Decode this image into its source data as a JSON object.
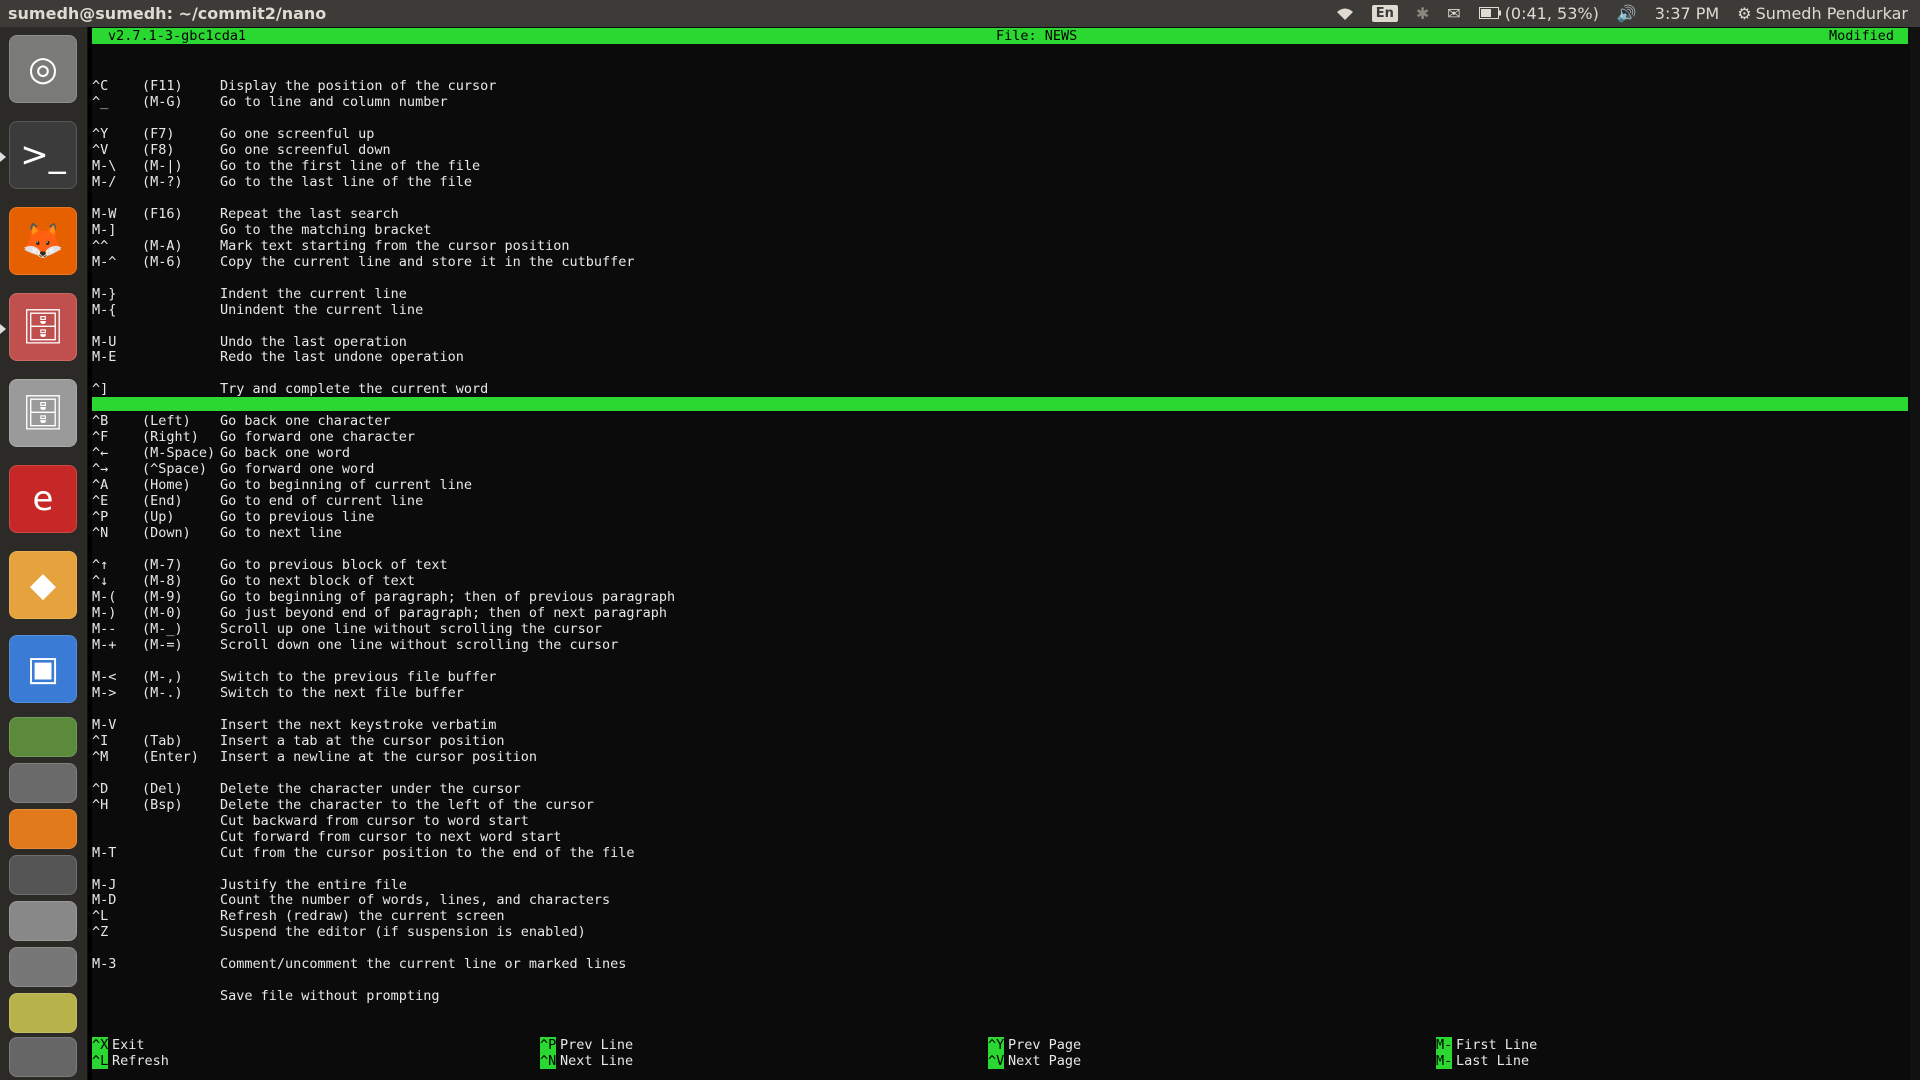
{
  "panel": {
    "window_title": "sumedh@sumedh: ~/commit2/nano",
    "lang": "En",
    "battery": "(0:41, 53%)",
    "time": "3:37 PM",
    "user": "Sumedh Pendurkar"
  },
  "launcher": {
    "items": [
      {
        "name": "dash",
        "glyph": "◎",
        "color": "#7a7a78"
      },
      {
        "name": "terminal",
        "glyph": ">_",
        "color": "#3b3b3b"
      },
      {
        "name": "firefox",
        "glyph": "🦊",
        "color": "#e66000"
      },
      {
        "name": "files",
        "glyph": "🗄",
        "color": "#c0504d"
      },
      {
        "name": "files-2",
        "glyph": "🗄",
        "color": "#9a9a9a"
      },
      {
        "name": "evince",
        "glyph": "e",
        "color": "#c62828"
      },
      {
        "name": "libreoffice-draw",
        "glyph": "◆",
        "color": "#e6a23c"
      },
      {
        "name": "image-viewer",
        "glyph": "▣",
        "color": "#3a7bd5"
      }
    ]
  },
  "nano": {
    "version": "v2.7.1-3-gbc1cda1",
    "file": "File: NEWS",
    "status": "Modified",
    "help": [
      {
        "key": "^C",
        "alt": "(F11)",
        "desc": "Display the position of the cursor"
      },
      {
        "key": "^_",
        "alt": "(M-G)",
        "desc": "Go to line and column number"
      },
      {
        "key": "",
        "alt": "",
        "desc": ""
      },
      {
        "key": "^Y",
        "alt": "(F7)",
        "desc": "Go one screenful up"
      },
      {
        "key": "^V",
        "alt": "(F8)",
        "desc": "Go one screenful down"
      },
      {
        "key": "M-\\",
        "alt": "(M-|)",
        "desc": "Go to the first line of the file"
      },
      {
        "key": "M-/",
        "alt": "(M-?)",
        "desc": "Go to the last line of the file"
      },
      {
        "key": "",
        "alt": "",
        "desc": ""
      },
      {
        "key": "M-W",
        "alt": "(F16)",
        "desc": "Repeat the last search"
      },
      {
        "key": "M-]",
        "alt": "",
        "desc": "Go to the matching bracket"
      },
      {
        "key": "^^",
        "alt": "(M-A)",
        "desc": "Mark text starting from the cursor position"
      },
      {
        "key": "M-^",
        "alt": "(M-6)",
        "desc": "Copy the current line and store it in the cutbuffer"
      },
      {
        "key": "",
        "alt": "",
        "desc": ""
      },
      {
        "key": "M-}",
        "alt": "",
        "desc": "Indent the current line"
      },
      {
        "key": "M-{",
        "alt": "",
        "desc": "Unindent the current line"
      },
      {
        "key": "",
        "alt": "",
        "desc": ""
      },
      {
        "key": "M-U",
        "alt": "",
        "desc": "Undo the last operation"
      },
      {
        "key": "M-E",
        "alt": "",
        "desc": "Redo the last undone operation"
      },
      {
        "key": "",
        "alt": "",
        "desc": ""
      },
      {
        "key": "^]",
        "alt": "",
        "desc": "Try and complete the current word"
      },
      {
        "key": "",
        "alt": "",
        "desc": ""
      },
      {
        "key": "^B",
        "alt": "(Left)",
        "desc": "Go back one character"
      },
      {
        "key": "^F",
        "alt": "(Right)",
        "desc": "Go forward one character"
      },
      {
        "key": "^←",
        "alt": "(M-Space)",
        "desc": "Go back one word"
      },
      {
        "key": "^→",
        "alt": "(^Space)",
        "desc": "Go forward one word"
      },
      {
        "key": "^A",
        "alt": "(Home)",
        "desc": "Go to beginning of current line"
      },
      {
        "key": "^E",
        "alt": "(End)",
        "desc": "Go to end of current line"
      },
      {
        "key": "^P",
        "alt": "(Up)",
        "desc": "Go to previous line"
      },
      {
        "key": "^N",
        "alt": "(Down)",
        "desc": "Go to next line"
      },
      {
        "key": "",
        "alt": "",
        "desc": ""
      },
      {
        "key": "^↑",
        "alt": "(M-7)",
        "desc": "Go to previous block of text"
      },
      {
        "key": "^↓",
        "alt": "(M-8)",
        "desc": "Go to next block of text"
      },
      {
        "key": "M-(",
        "alt": "(M-9)",
        "desc": "Go to beginning of paragraph; then of previous paragraph"
      },
      {
        "key": "M-)",
        "alt": "(M-0)",
        "desc": "Go just beyond end of paragraph; then of next paragraph"
      },
      {
        "key": "M--",
        "alt": "(M-_)",
        "desc": "Scroll up one line without scrolling the cursor"
      },
      {
        "key": "M-+",
        "alt": "(M-=)",
        "desc": "Scroll down one line without scrolling the cursor"
      },
      {
        "key": "",
        "alt": "",
        "desc": ""
      },
      {
        "key": "M-<",
        "alt": "(M-,)",
        "desc": "Switch to the previous file buffer"
      },
      {
        "key": "M->",
        "alt": "(M-.)",
        "desc": "Switch to the next file buffer"
      },
      {
        "key": "",
        "alt": "",
        "desc": ""
      },
      {
        "key": "M-V",
        "alt": "",
        "desc": "Insert the next keystroke verbatim"
      },
      {
        "key": "^I",
        "alt": "(Tab)",
        "desc": "Insert a tab at the cursor position"
      },
      {
        "key": "^M",
        "alt": "(Enter)",
        "desc": "Insert a newline at the cursor position"
      },
      {
        "key": "",
        "alt": "",
        "desc": ""
      },
      {
        "key": "^D",
        "alt": "(Del)",
        "desc": "Delete the character under the cursor"
      },
      {
        "key": "^H",
        "alt": "(Bsp)",
        "desc": "Delete the character to the left of the cursor"
      },
      {
        "key": "",
        "alt": "",
        "desc": "Cut backward from cursor to word start"
      },
      {
        "key": "",
        "alt": "",
        "desc": "Cut forward from cursor to next word start"
      },
      {
        "key": "M-T",
        "alt": "",
        "desc": "Cut from the cursor position to the end of the file"
      },
      {
        "key": "",
        "alt": "",
        "desc": ""
      },
      {
        "key": "M-J",
        "alt": "",
        "desc": "Justify the entire file"
      },
      {
        "key": "M-D",
        "alt": "",
        "desc": "Count the number of words, lines, and characters"
      },
      {
        "key": "^L",
        "alt": "",
        "desc": "Refresh (redraw) the current screen"
      },
      {
        "key": "^Z",
        "alt": "",
        "desc": "Suspend the editor (if suspension is enabled)"
      },
      {
        "key": "",
        "alt": "",
        "desc": ""
      },
      {
        "key": "M-3",
        "alt": "",
        "desc": "Comment/uncomment the current line or marked lines"
      },
      {
        "key": "",
        "alt": "",
        "desc": ""
      },
      {
        "key": "",
        "alt": "",
        "desc": "Save file without prompting"
      }
    ],
    "shortcuts": [
      {
        "key": "^X",
        "label": "Exit"
      },
      {
        "key": "^L",
        "label": "Refresh"
      },
      {
        "key": "^P",
        "label": "Prev Line"
      },
      {
        "key": "^N",
        "label": "Next Line"
      },
      {
        "key": "^Y",
        "label": "Prev Page"
      },
      {
        "key": "^V",
        "label": "Next Page"
      },
      {
        "key": "M-\\",
        "label": "First Line"
      },
      {
        "key": "M-/",
        "label": "Last Line"
      }
    ]
  },
  "colors": {
    "accent": "#2bd832"
  }
}
